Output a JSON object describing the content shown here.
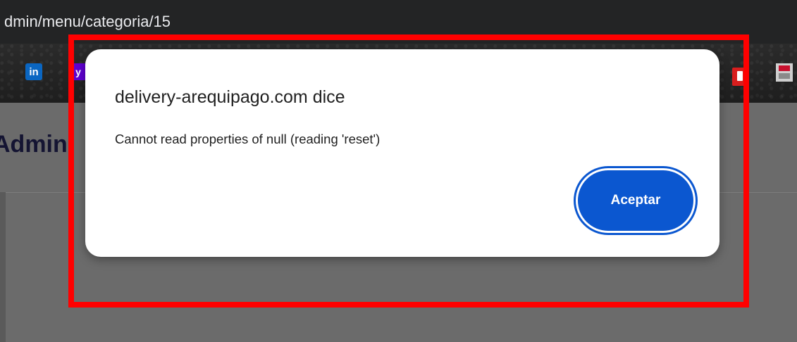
{
  "browser": {
    "address_text": "dmin/menu/categoria/15"
  },
  "bookmarks": {
    "linkedin_icon_text": "in",
    "yahoo_icon_text": "y"
  },
  "page": {
    "heading_partial": "Admini"
  },
  "dialog": {
    "title": "delivery-arequipago.com dice",
    "message": "Cannot read properties of null (reading 'reset')",
    "ok_label": "Aceptar"
  },
  "colors": {
    "button_blue": "#0b57d0",
    "highlight_red": "#ff0000",
    "overlay_gray": "#6b6b6b"
  }
}
